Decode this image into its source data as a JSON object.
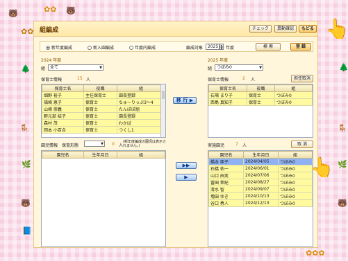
{
  "app": {
    "title": "組編成"
  },
  "toolbar": {
    "check": "チェック",
    "history": "異動確認",
    "back": "もどる"
  },
  "mode": {
    "options": [
      "新年度編成",
      "新入園編成",
      "年度内編成"
    ],
    "selected": 0,
    "target_label": "編成対象",
    "target_year": "2025",
    "year_suffix": "年度",
    "search": "検 索",
    "register": "登 録"
  },
  "left": {
    "year_label": "2024 年度",
    "class_label": "組",
    "class_value": "全て",
    "count_label": "保育士情報",
    "count_value": "15",
    "count_unit": "人",
    "columns": [
      "保育士名",
      "役職",
      "組"
    ],
    "rows": [
      [
        "畑野 裕子",
        "主任保育士",
        "園長登録"
      ],
      [
        "福崎 恵子",
        "保育士",
        "ちゅーりっぷ3～4"
      ],
      [
        "山崎 崇義",
        "保育士",
        "たんぽぽ組"
      ],
      [
        "野元部 結子",
        "保育士",
        "園長登録"
      ],
      [
        "森村 茂",
        "保育士",
        "わかば"
      ],
      [
        "岡本 小百合",
        "保育士",
        "つくし1"
      ]
    ]
  },
  "move_button": "移 行 ▶",
  "right": {
    "year_label": "2025 年度",
    "class_label": "組",
    "class_value": "つぼみ0",
    "count_label": "保育士情報",
    "count_value": "2",
    "count_unit": "人",
    "cancel": "担任取消",
    "columns": [
      "保育士名",
      "役職",
      "組"
    ],
    "rows": [
      [
        "石場 まり子",
        "保育士",
        "つぼみ0"
      ],
      [
        "西島 真知子",
        "保育士",
        "つぼみ0"
      ]
    ]
  },
  "child_left": {
    "label": "園児情報",
    "filter_label": "保育形態",
    "count_value": "0",
    "count_unit": "人",
    "note": "(新年度編成の園児は表示されません。)",
    "columns": [
      "園児名",
      "生年月日",
      "組"
    ]
  },
  "child_right": {
    "label": "実施園児",
    "count_value": "7",
    "count_unit": "人",
    "cancel": "取 消",
    "columns": [
      "園児名",
      "生年月日",
      "組"
    ],
    "rows": [
      [
        "橋本 亜子",
        "2024/04/05",
        "つぼみ0"
      ],
      [
        "石橋 佑一",
        "2024/06/01",
        "つぼみ0"
      ],
      [
        "山口 由実",
        "2024/07/06",
        "つぼみ0"
      ],
      [
        "富田 茉紀",
        "2024/08/27",
        "つぼみ0"
      ],
      [
        "清水 智",
        "2024/09/07",
        "つぼみ0"
      ],
      [
        "増田 ゆき",
        "2024/10/13",
        "つぼみ0"
      ],
      [
        "谷口 勇人",
        "2024/12/13",
        "つぼみ0"
      ]
    ],
    "selected_row": 0
  },
  "arrows": {
    "all": "▶▶",
    "one": "▶"
  }
}
